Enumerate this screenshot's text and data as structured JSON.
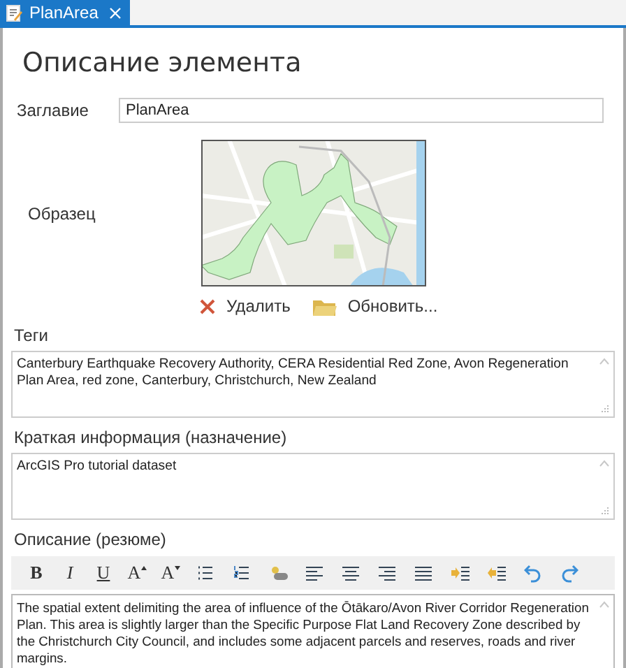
{
  "tab": {
    "title": "PlanArea",
    "selected": true
  },
  "heading": "Описание элемента",
  "title_field": {
    "label": "Заглавие",
    "value": "PlanArea"
  },
  "thumbnail": {
    "label": "Образец",
    "kind": "picture"
  },
  "thumbnail_actions": [
    {
      "kind": "delete",
      "label": "Удалить"
    },
    {
      "kind": "update",
      "label": "Обновить..."
    }
  ],
  "tags": {
    "label": "Теги",
    "value": "Canterbury Earthquake Recovery Authority, CERA Residential Red Zone, Avon Regeneration Plan Area, red zone, Canterbury, Christchurch, New Zealand"
  },
  "summary": {
    "label": "Краткая информация (назначение)",
    "value": "ArcGIS Pro tutorial dataset"
  },
  "description": {
    "label": "Описание (резюме)",
    "toolbar": [
      {
        "kind": "bold",
        "label": "B"
      },
      {
        "kind": "italic",
        "label": "I"
      },
      {
        "kind": "underline",
        "label": "U"
      },
      {
        "kind": "grow",
        "label": "A"
      },
      {
        "kind": "shrink",
        "label": "A"
      },
      {
        "kind": "bullets"
      },
      {
        "kind": "numbers"
      },
      {
        "kind": "link"
      },
      {
        "kind": "align-left"
      },
      {
        "kind": "align-center"
      },
      {
        "kind": "align-right"
      },
      {
        "kind": "justify"
      },
      {
        "kind": "indent"
      },
      {
        "kind": "outdent"
      },
      {
        "kind": "undo"
      },
      {
        "kind": "redo"
      }
    ],
    "value": "The spatial extent delimiting the area of influence of the Ōtākaro/Avon River Corridor Regeneration Plan. This area is slightly larger than the Specific Purpose Flat Land Recovery Zone described by the Christchurch City Council, and includes some adjacent parcels and reserves, roads and river margins."
  }
}
